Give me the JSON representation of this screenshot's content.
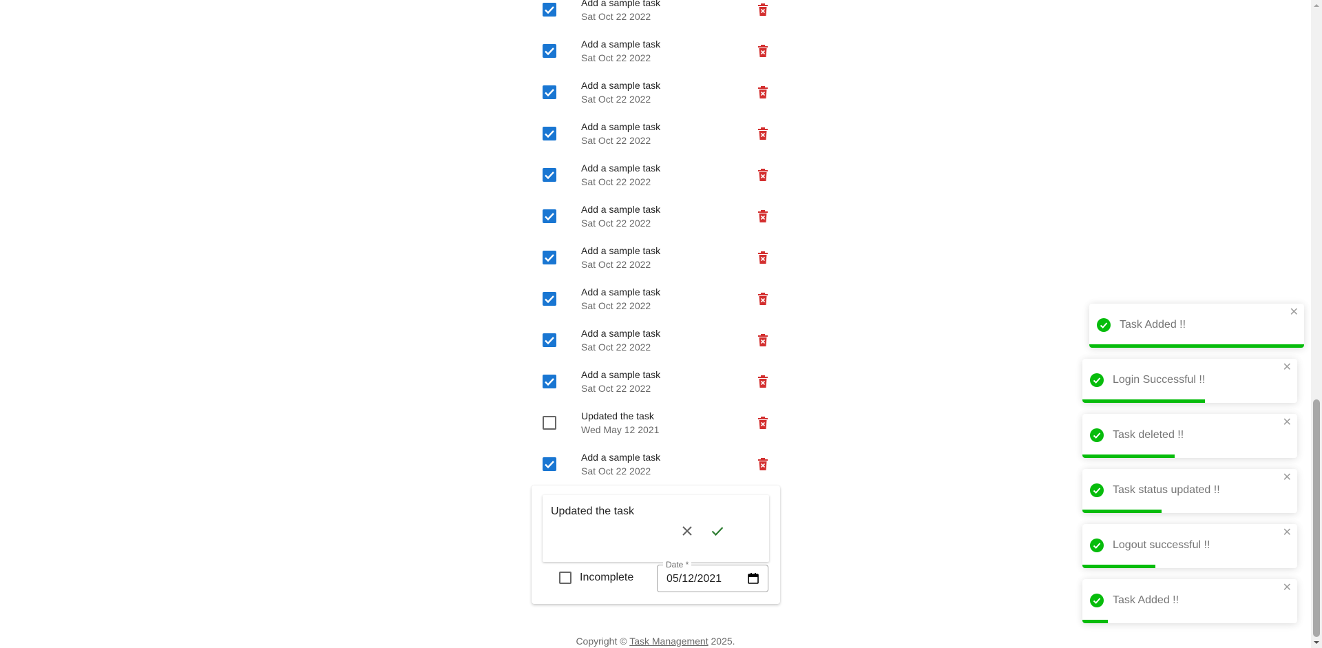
{
  "tasks": [
    {
      "name": "Add a sample task",
      "date": "Sat Oct 22 2022",
      "completed": true
    },
    {
      "name": "Add a sample task",
      "date": "Sat Oct 22 2022",
      "completed": true
    },
    {
      "name": "Add a sample task",
      "date": "Sat Oct 22 2022",
      "completed": true
    },
    {
      "name": "Add a sample task",
      "date": "Sat Oct 22 2022",
      "completed": true
    },
    {
      "name": "Add a sample task",
      "date": "Sat Oct 22 2022",
      "completed": true
    },
    {
      "name": "Add a sample task",
      "date": "Sat Oct 22 2022",
      "completed": true
    },
    {
      "name": "Add a sample task",
      "date": "Sat Oct 22 2022",
      "completed": true
    },
    {
      "name": "Add a sample task",
      "date": "Sat Oct 22 2022",
      "completed": true
    },
    {
      "name": "Add a sample task",
      "date": "Sat Oct 22 2022",
      "completed": true
    },
    {
      "name": "Add a sample task",
      "date": "Sat Oct 22 2022",
      "completed": true
    },
    {
      "name": "Updated the task",
      "date": "Wed May 12 2021",
      "completed": false
    },
    {
      "name": "Add a sample task",
      "date": "Sat Oct 22 2022",
      "completed": true
    }
  ],
  "edit_form": {
    "task_value": "Updated the task",
    "status_label": "Incomplete",
    "date_label": "Date *",
    "date_value": "05/12/2021"
  },
  "footer": {
    "prefix": "Copyright © ",
    "link_text": "Task Management",
    "suffix": " 2025."
  },
  "toasts": [
    {
      "message": "Task Added !!",
      "close": "✕",
      "progress": 1.0
    },
    {
      "message": "Login Successful !!",
      "close": "✕",
      "progress": 0.57
    },
    {
      "message": "Task deleted !!",
      "close": "✕",
      "progress": 0.43
    },
    {
      "message": "Task status updated !!",
      "close": "✕",
      "progress": 0.37
    },
    {
      "message": "Logout successful !!",
      "close": "✕",
      "progress": 0.34
    },
    {
      "message": "Task Added !!",
      "close": "✕",
      "progress": 0.12
    }
  ],
  "colors": {
    "checkbox_checked": "#1976d2",
    "delete_icon": "#d32f2f",
    "toast_success": "#07bc0c",
    "confirm_icon": "#2e7d32"
  },
  "icons": {
    "delete": "delete-forever-icon",
    "cancel": "close-icon",
    "confirm": "check-icon",
    "calendar": "calendar-icon",
    "toast": "check-circle-icon"
  }
}
